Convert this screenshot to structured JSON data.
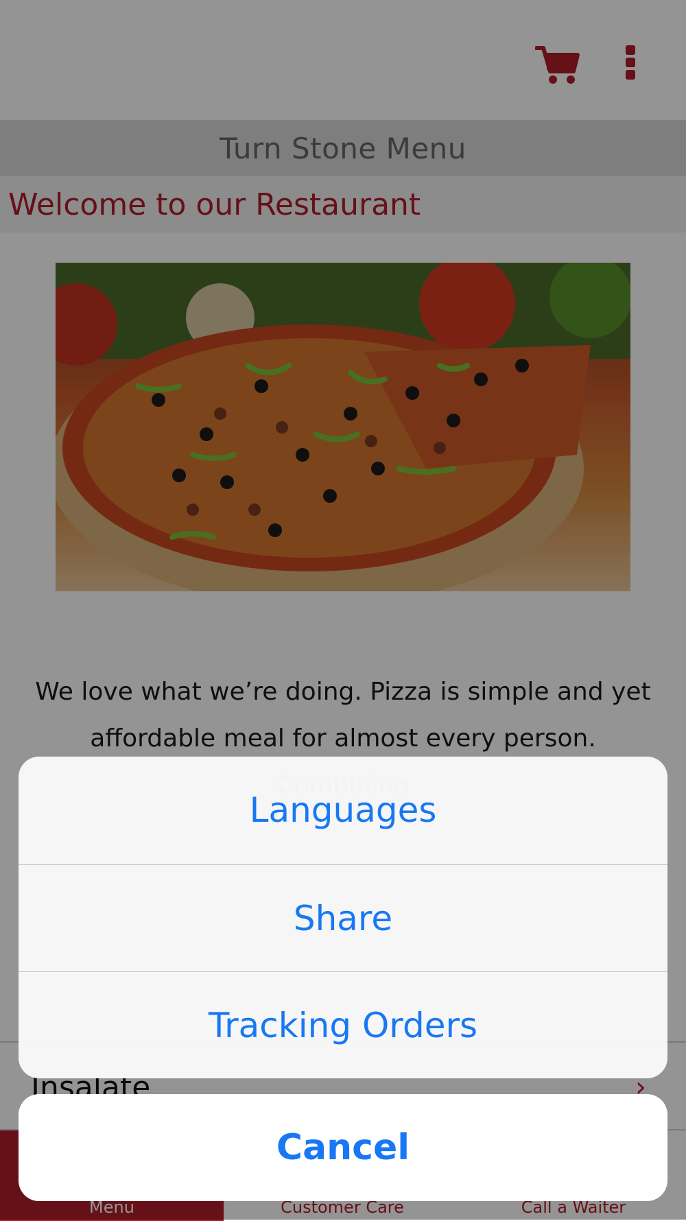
{
  "app": {
    "title_band": "Turn Stone Menu",
    "welcome": "Welcome to our Restaurant",
    "about_text": "We love what we’re doing. Pizza is simple and yet affordable meal for almost every person. Combining",
    "category_label": "Insalate",
    "hero_image": "pizza-image"
  },
  "toolbar": {
    "cart_icon": "cart-icon",
    "more_icon": "more-vertical-icon"
  },
  "tabbar": {
    "items": [
      {
        "label": "Menu"
      },
      {
        "label": "Customer Care"
      },
      {
        "label": "Call a Waiter"
      }
    ]
  },
  "action_sheet": {
    "options": [
      {
        "label": "Languages"
      },
      {
        "label": "Share"
      },
      {
        "label": "Tracking Orders"
      }
    ],
    "cancel_label": "Cancel"
  },
  "colors": {
    "brand": "#b01c2a",
    "ios_blue": "#1878f3"
  }
}
